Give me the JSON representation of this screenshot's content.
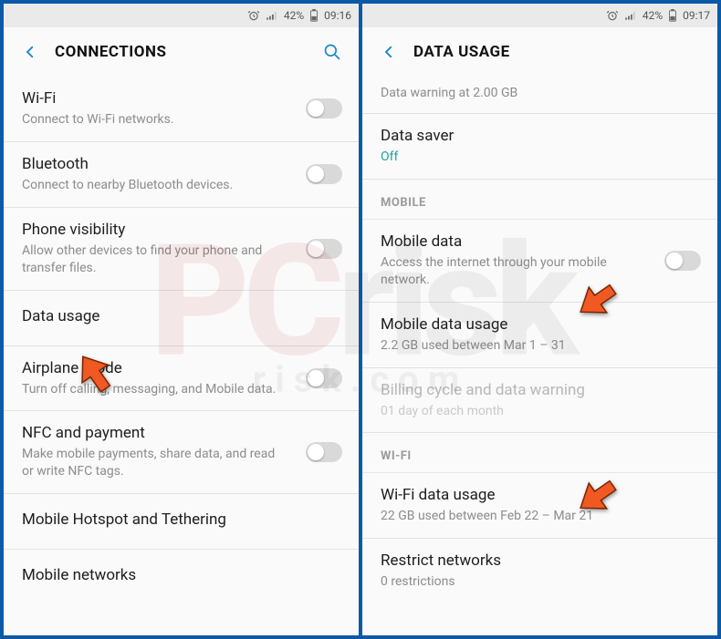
{
  "left": {
    "status": {
      "battery": "42%",
      "time": "09:16"
    },
    "header": {
      "title": "CONNECTIONS"
    },
    "rows": {
      "wifi": {
        "title": "Wi-Fi",
        "sub": "Connect to Wi-Fi networks."
      },
      "bt": {
        "title": "Bluetooth",
        "sub": "Connect to nearby Bluetooth devices."
      },
      "phonevis": {
        "title": "Phone visibility",
        "sub": "Allow other devices to find your phone and transfer files."
      },
      "datausage": {
        "title": "Data usage"
      },
      "airplane": {
        "title": "Airplane mode",
        "sub": "Turn off calling, messaging, and Mobile data."
      },
      "nfc": {
        "title": "NFC and payment",
        "sub": "Make mobile payments, share data, and read or write NFC tags."
      },
      "hotspot": {
        "title": "Mobile Hotspot and Tethering"
      },
      "networks": {
        "title": "Mobile networks"
      }
    }
  },
  "right": {
    "status": {
      "battery": "42%",
      "time": "09:17"
    },
    "header": {
      "title": "DATA USAGE"
    },
    "partial_sub": "Data warning at 2.00 GB",
    "rows": {
      "datasaver": {
        "title": "Data saver",
        "sub": "Off"
      },
      "section_mobile": "MOBILE",
      "mobiledata": {
        "title": "Mobile data",
        "sub": "Access the internet through your mobile network."
      },
      "mobileusage": {
        "title": "Mobile data usage",
        "sub": "2.2 GB used between Mar 1 – 31"
      },
      "billing": {
        "title": "Billing cycle and data warning",
        "sub": "01 day of each month"
      },
      "section_wifi": "WI-FI",
      "wifiusage": {
        "title": "Wi-Fi data usage",
        "sub": "22 GB used between Feb 22 – Mar 21"
      },
      "restrict": {
        "title": "Restrict networks",
        "sub": "0 restrictions"
      }
    }
  },
  "watermark": {
    "big1": "PC",
    "big2": "risk",
    "sub": "risk.com"
  }
}
